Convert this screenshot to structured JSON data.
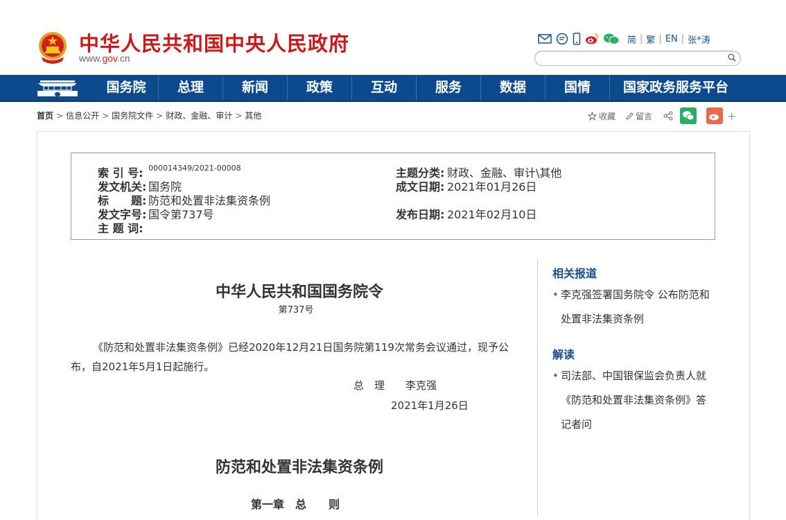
{
  "header": {
    "site_title": "中华人民共和国中央人民政府",
    "site_url_prefix": "www.",
    "site_url_domain": "gov",
    "site_url_suffix": ".cn",
    "lang": [
      "简",
      "繁",
      "EN",
      "张*涛"
    ],
    "search_placeholder": ""
  },
  "nav": {
    "items": [
      "国务院",
      "总理",
      "新闻",
      "政策",
      "互动",
      "服务",
      "数据",
      "国情",
      "国家政务服务平台"
    ]
  },
  "breadcrumb": [
    "首页",
    "信息公开",
    "国务院文件",
    "财政、金融、审计",
    "其他"
  ],
  "share": {
    "favorite": "收藏",
    "comment": "留言",
    "plus": "+"
  },
  "meta": {
    "index_label": "索 引 号:",
    "index_value": "000014349/2021-00008",
    "category_label": "主题分类:",
    "category_value": "财政、金融、审计\\其他",
    "issuer_label": "发文机关:",
    "issuer_value": "国务院",
    "written_label": "成文日期:",
    "written_value": "2021年01月26日",
    "title_label": "标　　题:",
    "title_value": "防范和处置非法集资条例",
    "docno_label": "发文字号:",
    "docno_value": "国令第737号",
    "published_label": "发布日期:",
    "published_value": "2021年02月10日",
    "keywords_label": "主 题 词:"
  },
  "article": {
    "title": "中华人民共和国国务院令",
    "number": "第737号",
    "paragraph": "《防范和处置非法集资条例》已经2020年12月21日国务院第119次常务会议通过，现予公布，自2021年5月1日起施行。",
    "signer_title": "总　理",
    "signer_name": "李克强",
    "date": "2021年1月26日",
    "regulation_title": "防范和处置非法集资条例",
    "chapter": "第一章　总　　则"
  },
  "sidebar": {
    "related_heading": "相关报道",
    "related_items": [
      "李克强签署国务院令 公布防范和处置非法集资条例"
    ],
    "interpret_heading": "解读",
    "interpret_items": [
      "司法部、中国银保监会负责人就《防范和处置非法集资条例》答记者问"
    ]
  }
}
